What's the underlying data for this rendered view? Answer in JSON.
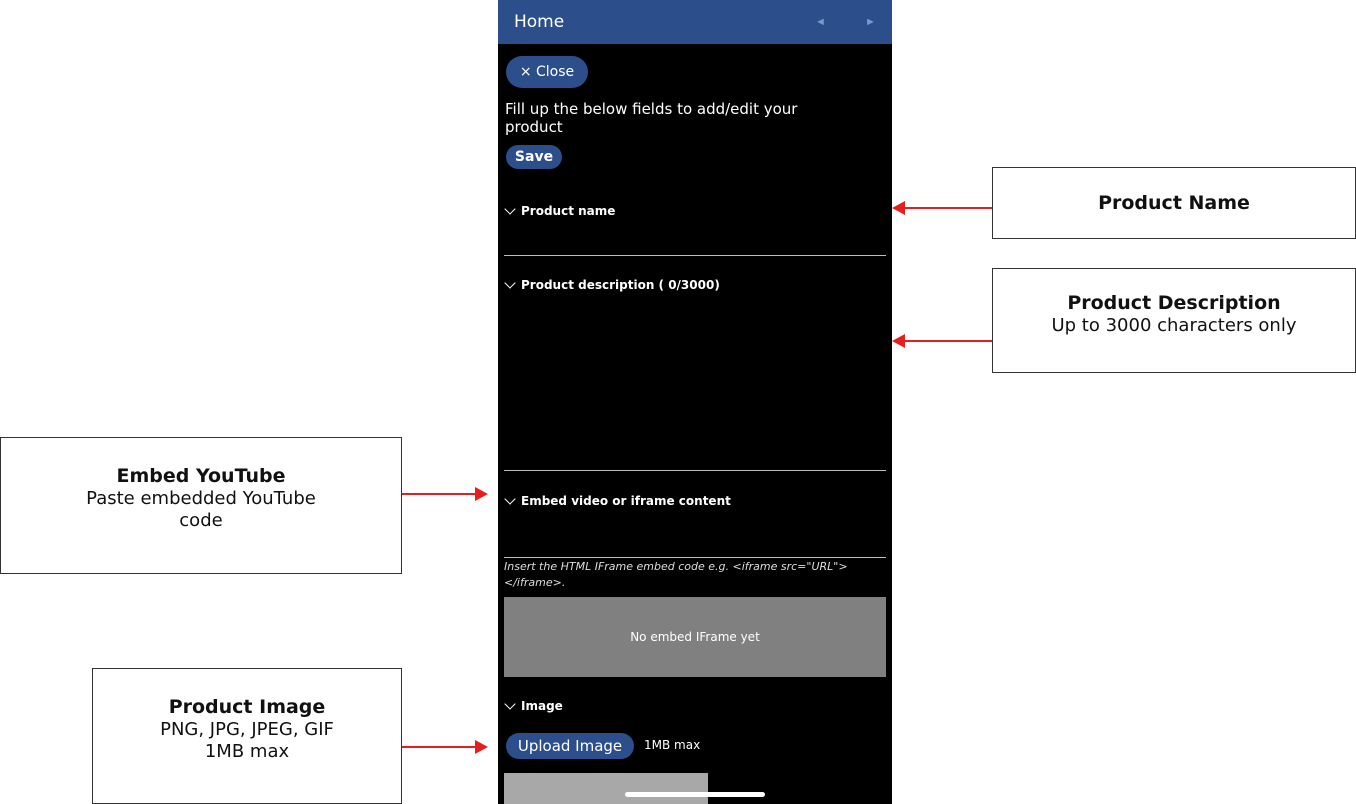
{
  "topbar": {
    "title": "Home",
    "prev_icon": "◄",
    "next_icon": "►"
  },
  "form": {
    "close_label": "× Close",
    "intro_text": "Fill up the below fields to add/edit your product",
    "save_label": "Save",
    "product_name_label": "Product name",
    "product_name_value": "",
    "description_label": "Product description ( 0/3000)",
    "description_value": "",
    "embed_label": "Embed video or iframe content",
    "embed_value": "",
    "embed_hint": "Insert the HTML IFrame embed code e.g. <iframe src=\"URL\"></iframe>.",
    "embed_preview_text": "No embed IFrame yet",
    "image_label": "Image",
    "upload_label": "Upload Image",
    "upload_note": "1MB max"
  },
  "callouts": {
    "product_name": {
      "title": "Product Name"
    },
    "product_description": {
      "title": "Product Description",
      "body": "Up to 3000 characters only"
    },
    "embed_youtube": {
      "title": "Embed YouTube",
      "body": "Paste embedded YouTube code"
    },
    "product_image": {
      "title": "Product Image",
      "body_line1": "PNG, JPG, JPEG, GIF",
      "body_line2": "1MB max"
    }
  },
  "colors": {
    "accent": "#2c4f8c",
    "arrow": "#e61e1e",
    "background": "#000000"
  }
}
